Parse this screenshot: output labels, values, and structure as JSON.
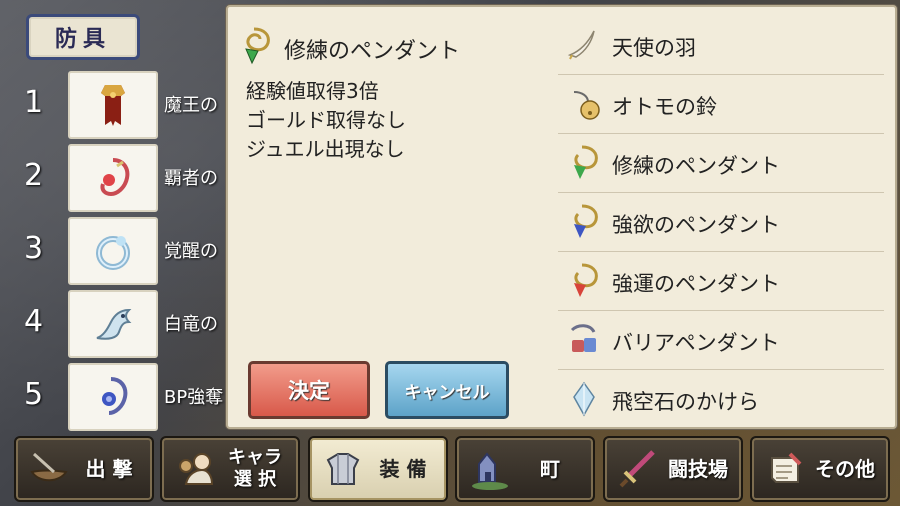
{
  "category_tab": "防具",
  "list": [
    {
      "num": "1",
      "name": "魔王の",
      "icon": "cape-icon"
    },
    {
      "num": "2",
      "name": "覇者の",
      "icon": "red-amulet-icon"
    },
    {
      "num": "3",
      "name": "覚醒の",
      "icon": "ring-icon"
    },
    {
      "num": "4",
      "name": "白竜の",
      "icon": "dragon-icon"
    },
    {
      "num": "5",
      "name": "BP強奪",
      "icon": "blue-pendant-icon"
    }
  ],
  "selected": {
    "title": "修練のペンダント",
    "desc": [
      "経験値取得3倍",
      "ゴールド取得なし",
      "ジュエル出現なし"
    ]
  },
  "buttons": {
    "ok": "決定",
    "cancel": "キャンセル"
  },
  "items": [
    {
      "label": "天使の羽",
      "icon": "feather-icon"
    },
    {
      "label": "オトモの鈴",
      "icon": "bell-icon"
    },
    {
      "label": "修練のペンダント",
      "icon": "green-pendant-icon"
    },
    {
      "label": "強欲のペンダント",
      "icon": "blue-pendant-icon"
    },
    {
      "label": "強運のペンダント",
      "icon": "red-pendant-icon"
    },
    {
      "label": "バリアペンダント",
      "icon": "barrier-pendant-icon"
    },
    {
      "label": "飛空石のかけら",
      "icon": "crystal-icon"
    }
  ],
  "nav": [
    {
      "label": "出 撃",
      "icon": "sortie-icon"
    },
    {
      "label": "キャラ\n選 択",
      "icon": "character-icon"
    },
    {
      "label": "装 備",
      "icon": "armor-icon"
    },
    {
      "label": "町",
      "icon": "town-icon"
    },
    {
      "label": "闘技場",
      "icon": "sword-icon"
    },
    {
      "label": "その他",
      "icon": "scroll-icon"
    }
  ]
}
